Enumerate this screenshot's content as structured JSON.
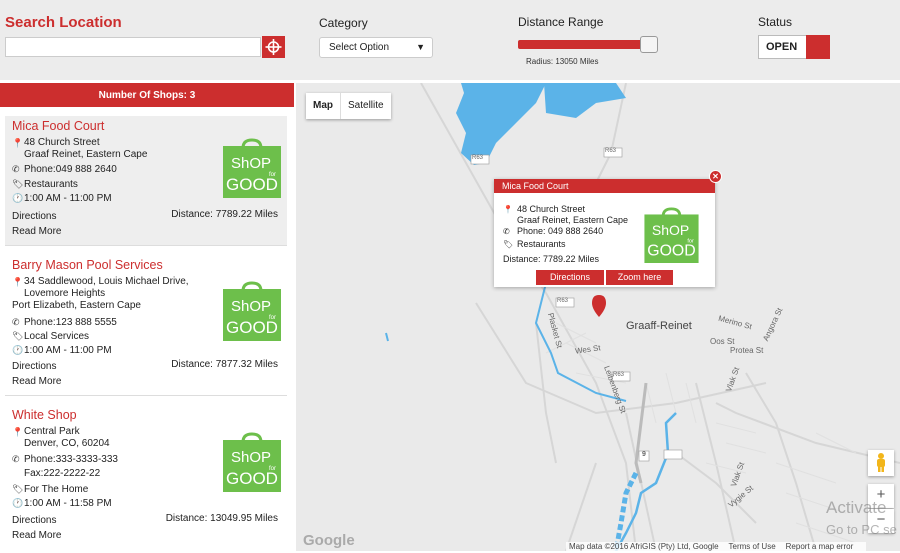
{
  "header": {
    "search_title": "Search Location",
    "search_value": "",
    "category_label": "Category",
    "category_selected": "Select Option",
    "distance_label": "Distance Range",
    "distance_fraction": 0.95,
    "radius_text": "Radius: 13050 Miles",
    "status_label": "Status",
    "status_value": "OPEN"
  },
  "sidebar": {
    "count_label": "Number Of Shops: 3",
    "shops": [
      {
        "name": "Mica Food Court",
        "address_line1": "48 Church Street",
        "address_line2": "Graaf Reinet, Eastern Cape",
        "phone": "Phone:049 888 2640",
        "category": "Restaurants",
        "hours": "1:00 AM - 11:00 PM",
        "directions": "Directions",
        "distance": "Distance: 7789.22 Miles",
        "read_more": "Read More"
      },
      {
        "name": "Barry Mason Pool Services",
        "address_line1": "34 Saddlewood, Louis Michael Drive,",
        "address_line2": "Lovemore Heights",
        "address_line3": "Port Elizabeth, Eastern Cape",
        "phone": "Phone:123 888 5555",
        "category": "Local Services",
        "hours": "1:00 AM - 11:00 PM",
        "directions": "Directions",
        "distance": "Distance: 7877.32 Miles",
        "read_more": "Read More"
      },
      {
        "name": "White Shop",
        "address_line1": "Central Park",
        "address_line2": "Denver, CO, 60204",
        "phone": "Phone:333-3333-333",
        "fax": "Fax:222-2222-22",
        "category": "For The Home",
        "hours": "1:00 AM - 11:58 PM",
        "directions": "Directions",
        "distance": "Distance: 13049.95 Miles",
        "read_more": "Read More"
      }
    ],
    "logo_text": {
      "top": "ShOP",
      "bottom": "GOOD",
      "side": "for"
    }
  },
  "map": {
    "type_map": "Map",
    "type_satellite": "Satellite",
    "info": {
      "title": "Mica Food Court",
      "address_line1": "48 Church Street",
      "address_line2": "Graaf Reinet, Eastern Cape",
      "phone": "Phone: 049 888 2640",
      "category": "Restaurants",
      "distance": "Distance: 7789.22 Miles",
      "directions": "Directions",
      "zoom": "Zoom here"
    },
    "town": "Graaff-Reinet",
    "streets": [
      "R63",
      "R63",
      "R63",
      "R63",
      "Plasket St",
      "Wes St",
      "Leibenberg St",
      "Merino St",
      "Angora St",
      "Oos St",
      "Protea St",
      "Vlak St",
      "Vlak St",
      "Vygie St"
    ],
    "route_marker": "9",
    "google": "Google",
    "attribution": [
      "Map data ©2016 AfriGIS (Pty) Ltd, Google",
      "Terms of Use",
      "Report a map error"
    ],
    "watermark_line1": "Activate",
    "watermark_line2": "Go to PC se"
  },
  "colors": {
    "accent": "#cc2e2e",
    "water": "#5bb3e8",
    "logo_green": "#6dbf4b",
    "map_bg": "#eaeaea"
  },
  "icons": [
    "crosshair-icon",
    "caret-down-icon",
    "map-pin-icon",
    "phone-icon",
    "tag-icon",
    "clock-icon",
    "close-icon",
    "pegman-icon",
    "zoom-in-icon",
    "zoom-out-icon",
    "marker-icon"
  ]
}
